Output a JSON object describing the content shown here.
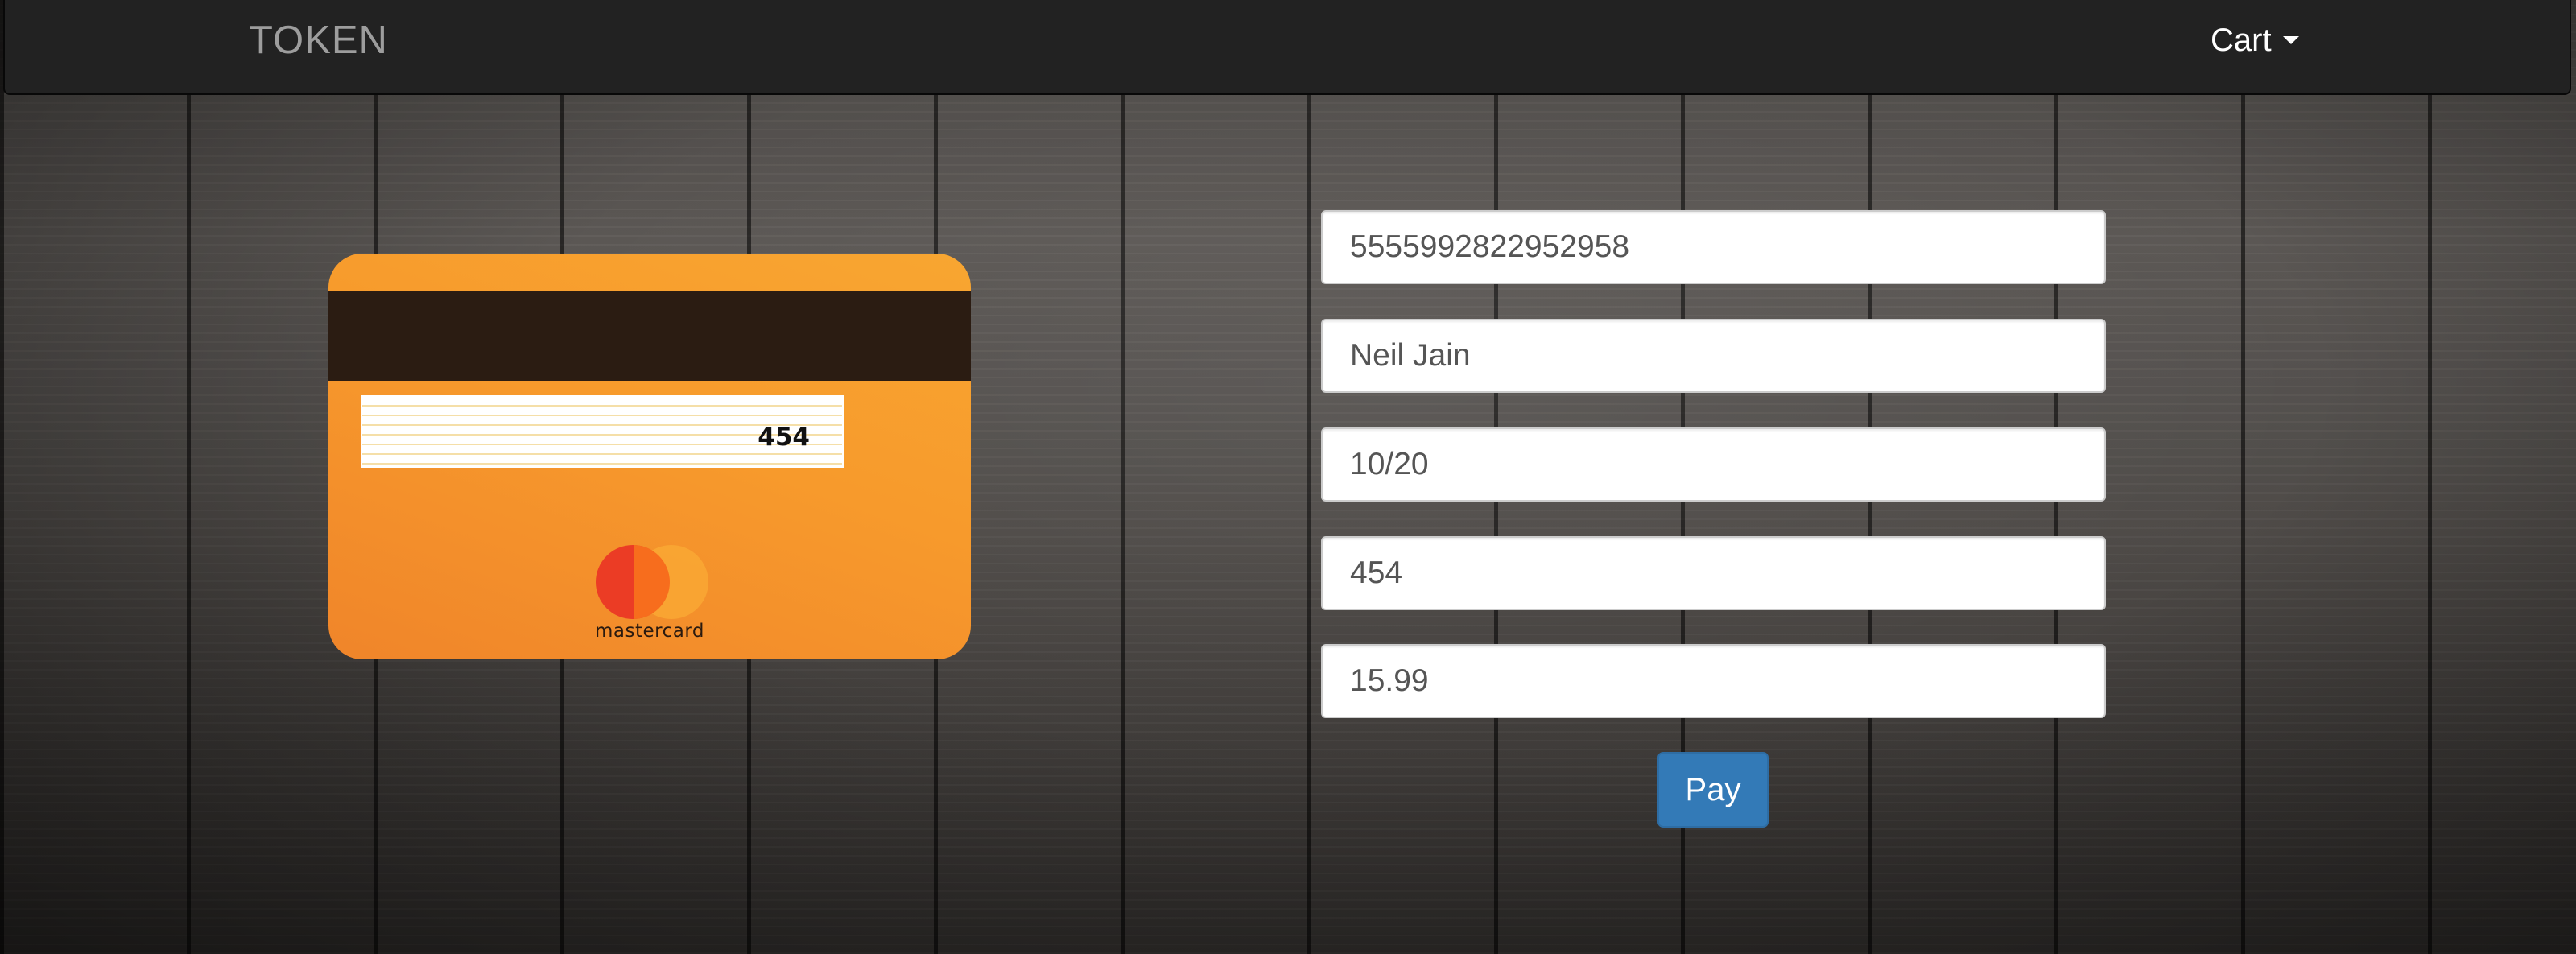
{
  "navbar": {
    "brand": "TOKEN",
    "cart_label": "Cart"
  },
  "card": {
    "cvv_display": "454",
    "network": "mastercard"
  },
  "form": {
    "card_number": "5555992822952958",
    "name": "Neil Jain",
    "expiry": "10/20",
    "cvv": "454",
    "amount": "15.99",
    "pay_label": "Pay"
  },
  "colors": {
    "navbar_bg": "#222222",
    "card_orange": "#f79a2c",
    "pay_button": "#337ab7",
    "mastercard_red": "#eb3c25",
    "mastercard_yellow": "#f9a533"
  },
  "icons": {
    "cart_dropdown": "caret-down-icon",
    "card_brand": "mastercard-logo"
  }
}
